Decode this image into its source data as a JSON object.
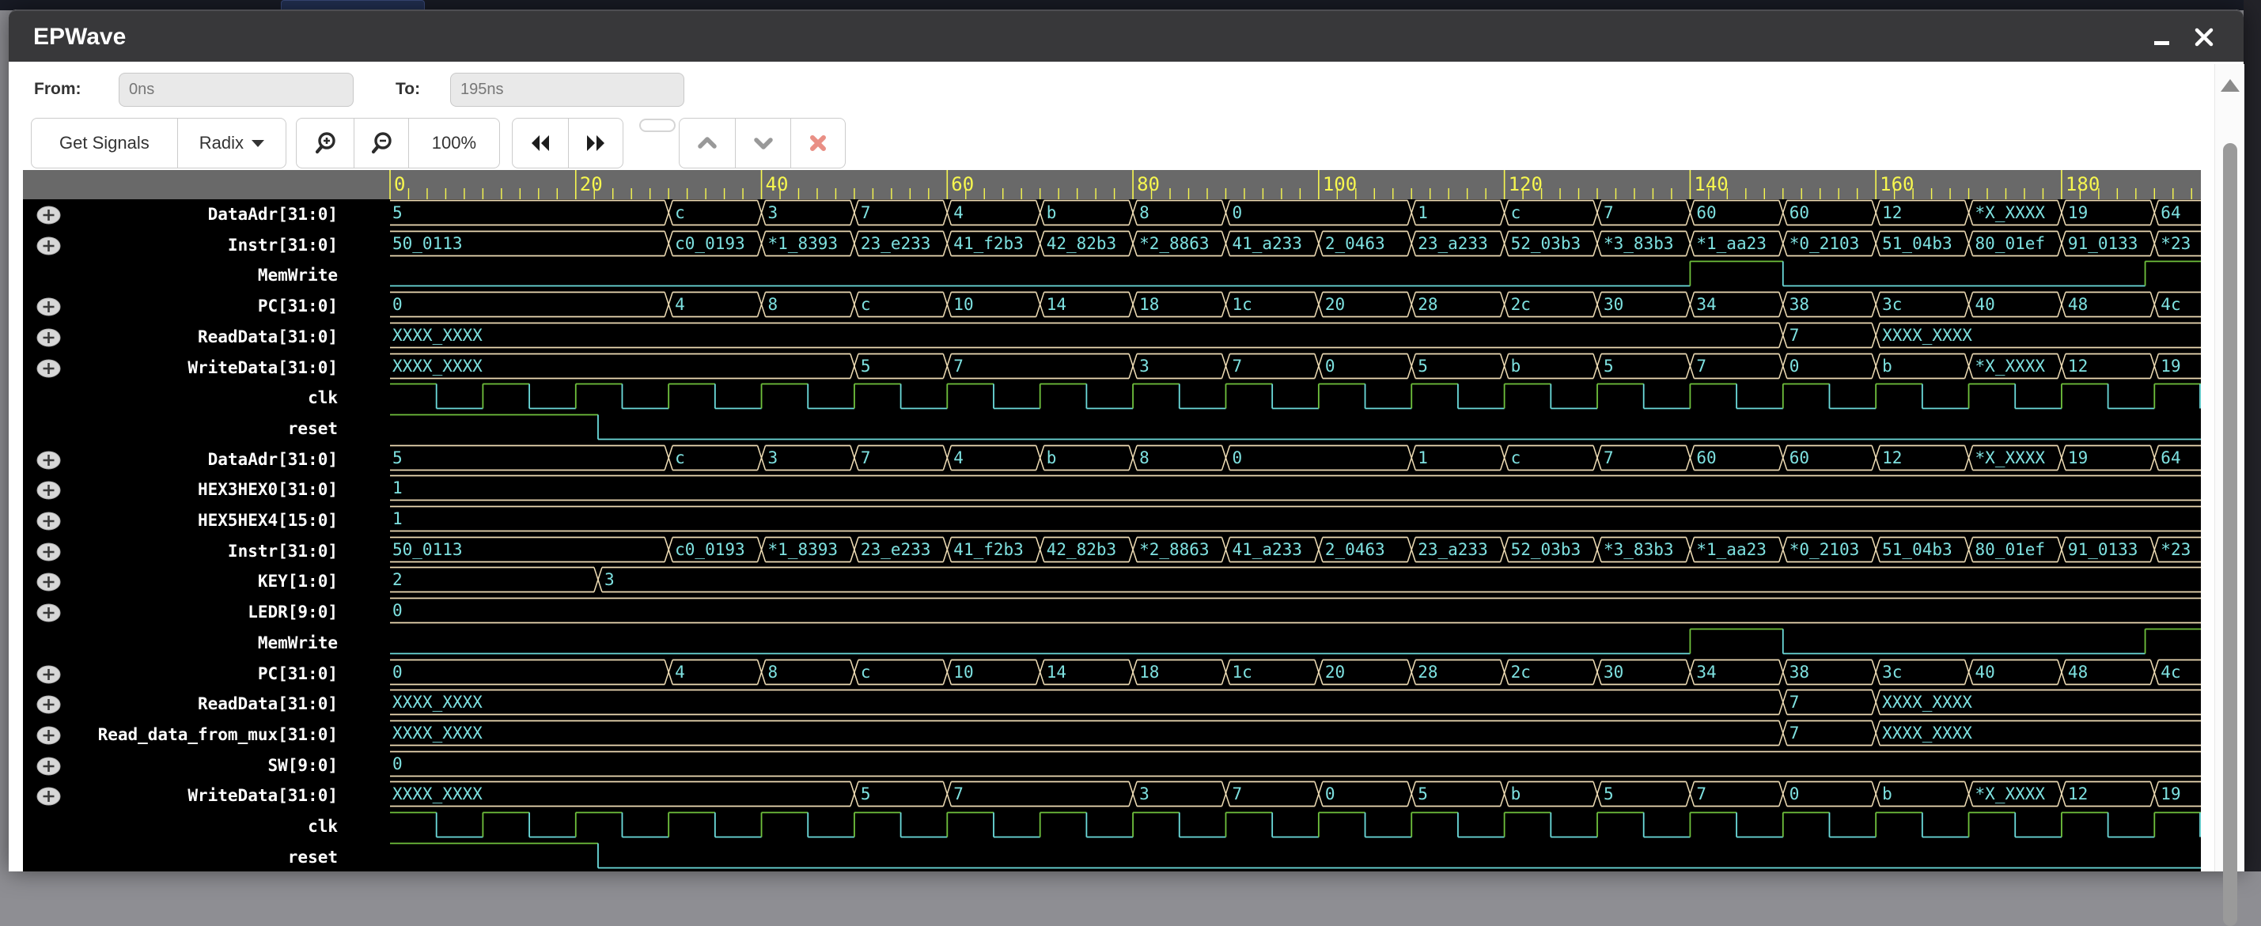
{
  "window": {
    "title": "EPWave"
  },
  "toolbar": {
    "from_label": "From:",
    "from_value": "0ns",
    "to_label": "To:",
    "to_value": "195ns",
    "get_signals_label": "Get Signals",
    "radix_label": "Radix",
    "zoom_level": "100%"
  },
  "ruler": {
    "unit": "ns",
    "start": 0,
    "end": 195,
    "major_step": 20,
    "minor_step": 2,
    "major_labels": [
      "0",
      "20",
      "40",
      "60",
      "80",
      "100",
      "120",
      "140",
      "160",
      "180"
    ]
  },
  "colors": {
    "bus_line": "#efddb5",
    "value_text": "#7ee1e0",
    "high_line": "#70c23d",
    "low_line": "#6cdcdc",
    "ruler_bg": "#696969",
    "tick": "#f7f74f",
    "panel_bg": "#000000",
    "name_text": "#ffffff"
  },
  "waves": {
    "dataadr": {
      "kind": "bus",
      "segments": [
        [
          0,
          30,
          "5"
        ],
        [
          30,
          40,
          "c"
        ],
        [
          40,
          50,
          "3"
        ],
        [
          50,
          60,
          "7"
        ],
        [
          60,
          70,
          "4"
        ],
        [
          70,
          80,
          "b"
        ],
        [
          80,
          90,
          "8"
        ],
        [
          90,
          110,
          "0"
        ],
        [
          110,
          120,
          "1"
        ],
        [
          120,
          130,
          "c"
        ],
        [
          130,
          140,
          "7"
        ],
        [
          140,
          150,
          "60"
        ],
        [
          150,
          160,
          "60"
        ],
        [
          160,
          170,
          "12"
        ],
        [
          170,
          180,
          "*X_XXXX"
        ],
        [
          180,
          190,
          "19"
        ],
        [
          190,
          195,
          "64"
        ]
      ]
    },
    "instr": {
      "kind": "bus",
      "segments": [
        [
          0,
          30,
          "50_0113"
        ],
        [
          30,
          40,
          "c0_0193"
        ],
        [
          40,
          50,
          "*1_8393"
        ],
        [
          50,
          60,
          "23_e233"
        ],
        [
          60,
          70,
          "41_f2b3"
        ],
        [
          70,
          80,
          "42_82b3"
        ],
        [
          80,
          90,
          "*2_8863"
        ],
        [
          90,
          100,
          "41_a233"
        ],
        [
          100,
          110,
          "2_0463"
        ],
        [
          110,
          120,
          "23_a233"
        ],
        [
          120,
          130,
          "52_03b3"
        ],
        [
          130,
          140,
          "*3_83b3"
        ],
        [
          140,
          150,
          "*1_aa23"
        ],
        [
          150,
          160,
          "*0_2103"
        ],
        [
          160,
          170,
          "51_04b3"
        ],
        [
          170,
          180,
          "80_01ef"
        ],
        [
          180,
          190,
          "91_0133"
        ],
        [
          190,
          195,
          "*23"
        ]
      ]
    },
    "memwrite": {
      "kind": "bit",
      "segments": [
        [
          0,
          140,
          0
        ],
        [
          140,
          150,
          1
        ],
        [
          150,
          189,
          0
        ],
        [
          189,
          195,
          1
        ]
      ]
    },
    "pc": {
      "kind": "bus",
      "segments": [
        [
          0,
          30,
          "0"
        ],
        [
          30,
          40,
          "4"
        ],
        [
          40,
          50,
          "8"
        ],
        [
          50,
          60,
          "c"
        ],
        [
          60,
          70,
          "10"
        ],
        [
          70,
          80,
          "14"
        ],
        [
          80,
          90,
          "18"
        ],
        [
          90,
          100,
          "1c"
        ],
        [
          100,
          110,
          "20"
        ],
        [
          110,
          120,
          "28"
        ],
        [
          120,
          130,
          "2c"
        ],
        [
          130,
          140,
          "30"
        ],
        [
          140,
          150,
          "34"
        ],
        [
          150,
          160,
          "38"
        ],
        [
          160,
          170,
          "3c"
        ],
        [
          170,
          180,
          "40"
        ],
        [
          180,
          190,
          "48"
        ],
        [
          190,
          195,
          "4c"
        ]
      ]
    },
    "readdata": {
      "kind": "bus",
      "segments": [
        [
          0,
          150,
          "XXXX_XXXX"
        ],
        [
          150,
          160,
          "7"
        ],
        [
          160,
          195,
          "XXXX_XXXX"
        ]
      ]
    },
    "read_data_from_mux": {
      "kind": "bus",
      "segments": [
        [
          0,
          150,
          "XXXX_XXXX"
        ],
        [
          150,
          160,
          "7"
        ],
        [
          160,
          195,
          "XXXX_XXXX"
        ]
      ]
    },
    "writedata": {
      "kind": "bus",
      "segments": [
        [
          0,
          50,
          "XXXX_XXXX"
        ],
        [
          50,
          60,
          "5"
        ],
        [
          60,
          80,
          "7"
        ],
        [
          80,
          90,
          "3"
        ],
        [
          90,
          100,
          "7"
        ],
        [
          100,
          110,
          "0"
        ],
        [
          110,
          120,
          "5"
        ],
        [
          120,
          130,
          "b"
        ],
        [
          130,
          140,
          "5"
        ],
        [
          140,
          150,
          "7"
        ],
        [
          150,
          160,
          "0"
        ],
        [
          160,
          170,
          "b"
        ],
        [
          170,
          180,
          "*X_XXXX"
        ],
        [
          180,
          190,
          "12"
        ],
        [
          190,
          195,
          "19"
        ]
      ]
    },
    "clk": {
      "kind": "bit",
      "end_fall": true,
      "segments": [
        [
          0,
          5,
          1
        ],
        [
          5,
          10,
          0
        ],
        [
          10,
          15,
          1
        ],
        [
          15,
          20,
          0
        ],
        [
          20,
          25,
          1
        ],
        [
          25,
          30,
          0
        ],
        [
          30,
          35,
          1
        ],
        [
          35,
          40,
          0
        ],
        [
          40,
          45,
          1
        ],
        [
          45,
          50,
          0
        ],
        [
          50,
          55,
          1
        ],
        [
          55,
          60,
          0
        ],
        [
          60,
          65,
          1
        ],
        [
          65,
          70,
          0
        ],
        [
          70,
          75,
          1
        ],
        [
          75,
          80,
          0
        ],
        [
          80,
          85,
          1
        ],
        [
          85,
          90,
          0
        ],
        [
          90,
          95,
          1
        ],
        [
          95,
          100,
          0
        ],
        [
          100,
          105,
          1
        ],
        [
          105,
          110,
          0
        ],
        [
          110,
          115,
          1
        ],
        [
          115,
          120,
          0
        ],
        [
          120,
          125,
          1
        ],
        [
          125,
          130,
          0
        ],
        [
          130,
          135,
          1
        ],
        [
          135,
          140,
          0
        ],
        [
          140,
          145,
          1
        ],
        [
          145,
          150,
          0
        ],
        [
          150,
          155,
          1
        ],
        [
          155,
          160,
          0
        ],
        [
          160,
          165,
          1
        ],
        [
          165,
          170,
          0
        ],
        [
          170,
          175,
          1
        ],
        [
          175,
          180,
          0
        ],
        [
          180,
          185,
          1
        ],
        [
          185,
          190,
          0
        ],
        [
          190,
          195,
          1
        ]
      ]
    },
    "reset": {
      "kind": "bit",
      "segments": [
        [
          0,
          22.4,
          1
        ],
        [
          22.4,
          195,
          0
        ]
      ]
    },
    "hex3hex0": {
      "kind": "bus",
      "segments": [
        [
          0,
          195,
          "1"
        ]
      ]
    },
    "hex5hex4": {
      "kind": "bus",
      "segments": [
        [
          0,
          195,
          "1"
        ]
      ]
    },
    "key": {
      "kind": "bus",
      "segments": [
        [
          0,
          22.4,
          "2"
        ],
        [
          22.4,
          195,
          "3"
        ]
      ]
    },
    "ledr": {
      "kind": "bus",
      "segments": [
        [
          0,
          195,
          "0"
        ]
      ]
    },
    "sw": {
      "kind": "bus",
      "segments": [
        [
          0,
          195,
          "0"
        ]
      ]
    }
  },
  "signals": [
    {
      "label": "DataAdr[31:0]",
      "expandable": true,
      "wave": "dataadr"
    },
    {
      "label": "Instr[31:0]",
      "expandable": true,
      "wave": "instr"
    },
    {
      "label": "MemWrite",
      "expandable": false,
      "wave": "memwrite"
    },
    {
      "label": "PC[31:0]",
      "expandable": true,
      "wave": "pc"
    },
    {
      "label": "ReadData[31:0]",
      "expandable": true,
      "wave": "readdata"
    },
    {
      "label": "WriteData[31:0]",
      "expandable": true,
      "wave": "writedata"
    },
    {
      "label": "clk",
      "expandable": false,
      "wave": "clk"
    },
    {
      "label": "reset",
      "expandable": false,
      "wave": "reset"
    },
    {
      "label": "DataAdr[31:0]",
      "expandable": true,
      "wave": "dataadr"
    },
    {
      "label": "HEX3HEX0[31:0]",
      "expandable": true,
      "wave": "hex3hex0"
    },
    {
      "label": "HEX5HEX4[15:0]",
      "expandable": true,
      "wave": "hex5hex4"
    },
    {
      "label": "Instr[31:0]",
      "expandable": true,
      "wave": "instr"
    },
    {
      "label": "KEY[1:0]",
      "expandable": true,
      "wave": "key"
    },
    {
      "label": "LEDR[9:0]",
      "expandable": true,
      "wave": "ledr"
    },
    {
      "label": "MemWrite",
      "expandable": false,
      "wave": "memwrite"
    },
    {
      "label": "PC[31:0]",
      "expandable": true,
      "wave": "pc"
    },
    {
      "label": "ReadData[31:0]",
      "expandable": true,
      "wave": "readdata"
    },
    {
      "label": "Read_data_from_mux[31:0]",
      "expandable": true,
      "wave": "read_data_from_mux"
    },
    {
      "label": "SW[9:0]",
      "expandable": true,
      "wave": "sw"
    },
    {
      "label": "WriteData[31:0]",
      "expandable": true,
      "wave": "writedata"
    },
    {
      "label": "clk",
      "expandable": false,
      "wave": "clk"
    },
    {
      "label": "reset",
      "expandable": false,
      "wave": "reset"
    }
  ]
}
